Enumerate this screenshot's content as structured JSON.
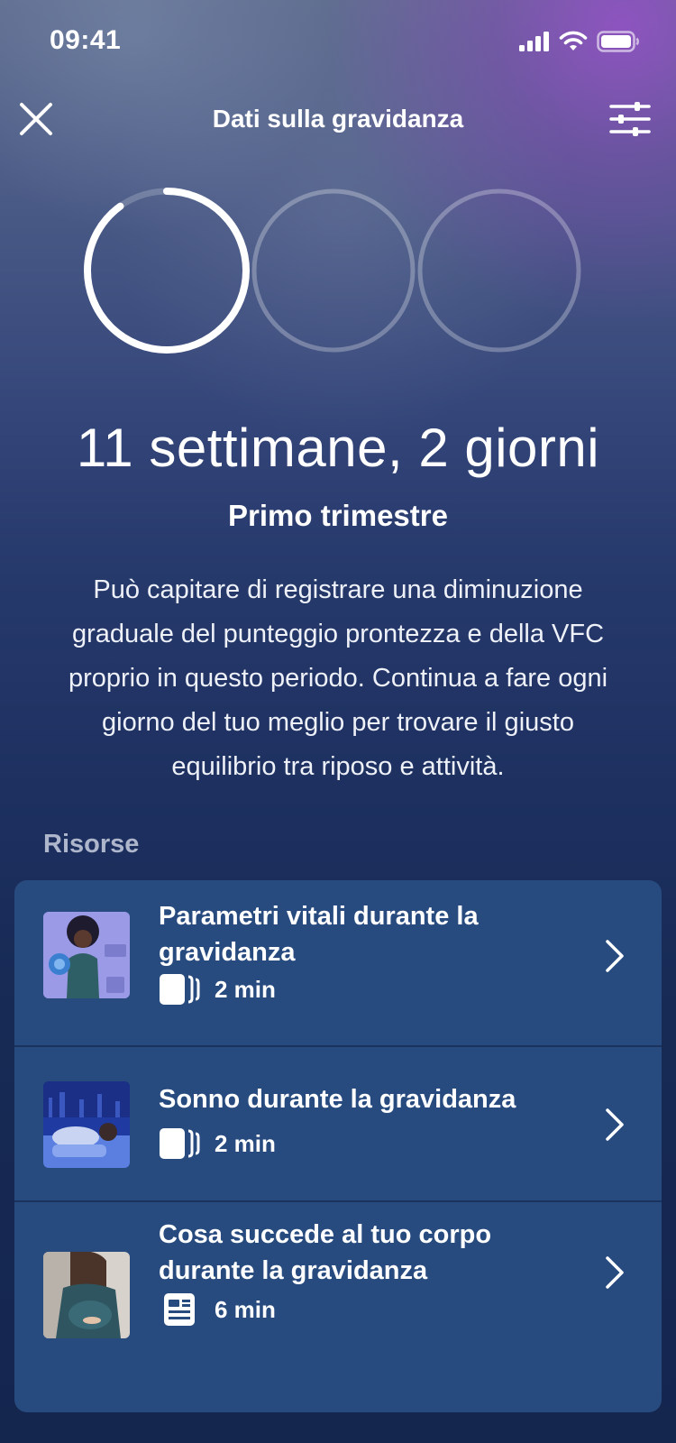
{
  "status_bar": {
    "time": "09:41"
  },
  "nav": {
    "title": "Dati sulla gravidanza"
  },
  "progress": {
    "segments": 3,
    "current_segment": 1,
    "current_fill": 0.9
  },
  "summary": {
    "headline": "11 settimane, 2 giorni",
    "trimester": "Primo trimestre",
    "description": "Può capitare di registrare una diminuzione graduale del punteggio prontezza e della VFC proprio in questo periodo. Continua a fare ogni giorno del tuo meglio per trovare il giusto equilibrio tra riposo e attività."
  },
  "resources": {
    "label": "Risorse",
    "items": [
      {
        "title": "Parametri vitali durante la gravidanza",
        "duration": "2 min",
        "type_icon": "cards-icon"
      },
      {
        "title": "Sonno durante la gravidanza",
        "duration": "2 min",
        "type_icon": "cards-icon"
      },
      {
        "title": "Cosa succede al tuo corpo durante la gravidanza",
        "duration": "6 min",
        "type_icon": "article-icon"
      }
    ]
  },
  "colors": {
    "card": "#274a7f",
    "accent_ring": "#ffffff"
  }
}
